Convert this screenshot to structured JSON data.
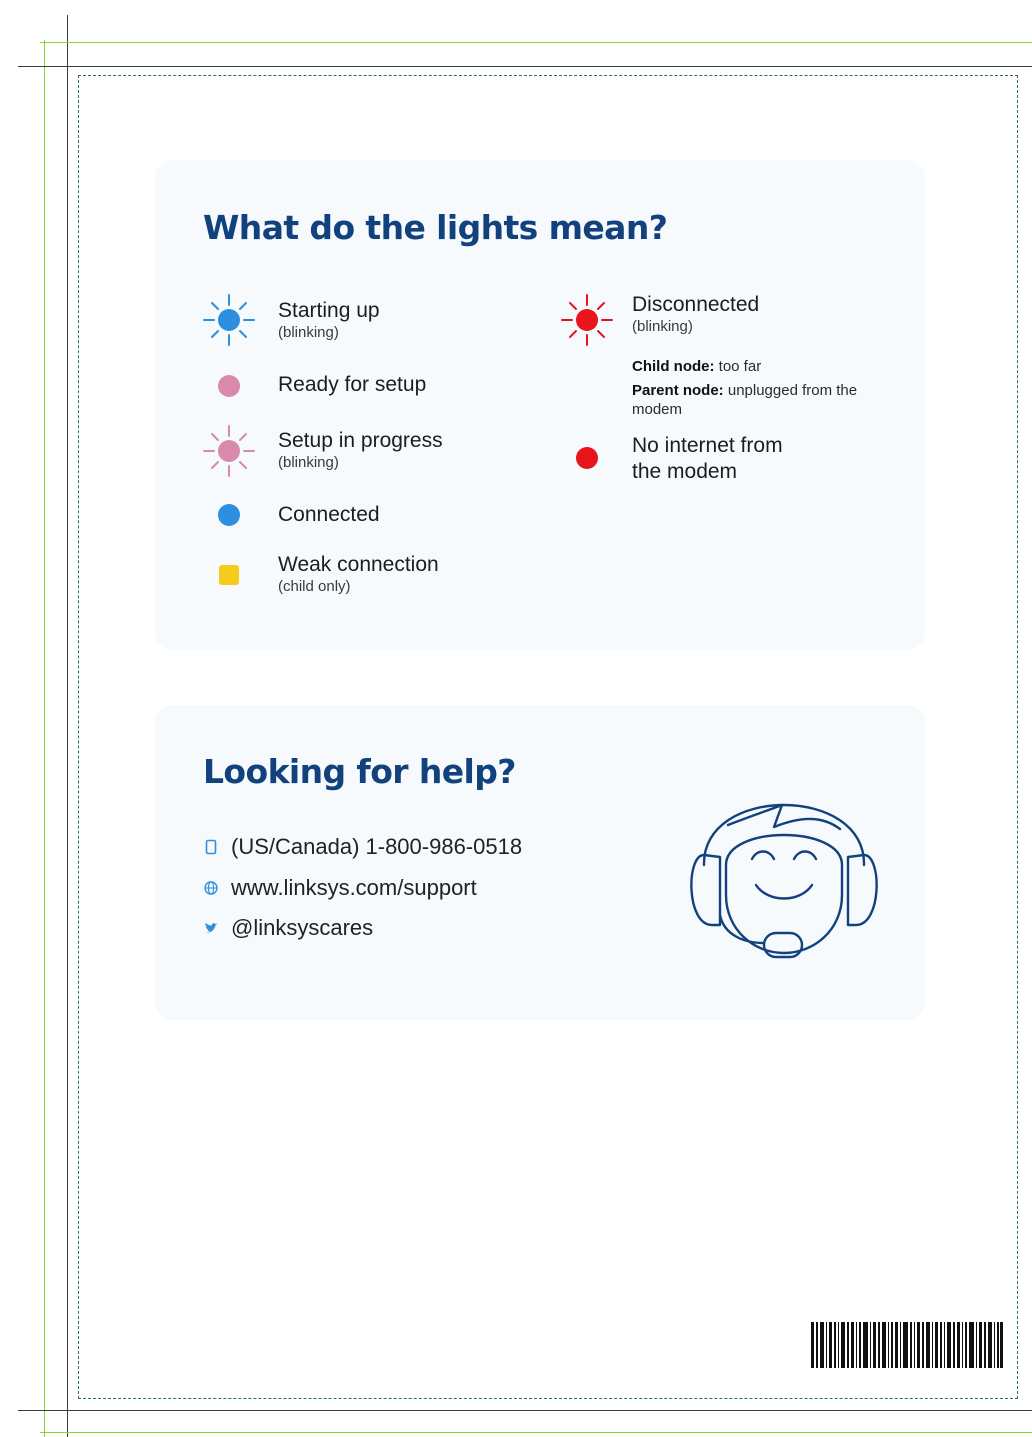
{
  "lights": {
    "title": "What do the lights mean?",
    "left_items": [
      {
        "label": "Starting up",
        "sub": "(blinking)",
        "color": "#2d8fe0",
        "mode": "blinking"
      },
      {
        "label": "Ready for setup",
        "sub": "",
        "color": "#d98aac",
        "mode": "solid"
      },
      {
        "label": "Setup in progress",
        "sub": "(blinking)",
        "color": "#d98aac",
        "mode": "blinking"
      },
      {
        "label": "Connected",
        "sub": "",
        "color": "#2d8fe0",
        "mode": "solid"
      },
      {
        "label": "Weak connection",
        "sub": "(child only)",
        "color": "#f5cc1b",
        "mode": "solid-square"
      }
    ],
    "right_items": [
      {
        "label": "Disconnected",
        "sub": "(blinking)",
        "color": "#e8141c",
        "mode": "blinking"
      },
      {
        "label_line1": "No internet from",
        "label_line2": "the modem",
        "color": "#e8141c",
        "mode": "solid"
      }
    ],
    "notes": [
      {
        "bold": "Child node:",
        "text": " too far"
      },
      {
        "bold": "Parent node:",
        "text": " unplugged from the modem"
      }
    ]
  },
  "help": {
    "title": "Looking for help?",
    "phone": "(US/Canada) 1-800-986-0518",
    "website": "www.linksys.com/support",
    "twitter": "@linksyscares",
    "icons": {
      "phone": "phone-icon",
      "web": "globe-icon",
      "twitter": "twitter-icon",
      "illustration": "support-agent-headset-icon"
    }
  },
  "colors": {
    "heading": "#12427d",
    "card_bg": "#f6fafd",
    "guide_green": "#8fd12e",
    "guide_dark": "#3a3a3a"
  }
}
